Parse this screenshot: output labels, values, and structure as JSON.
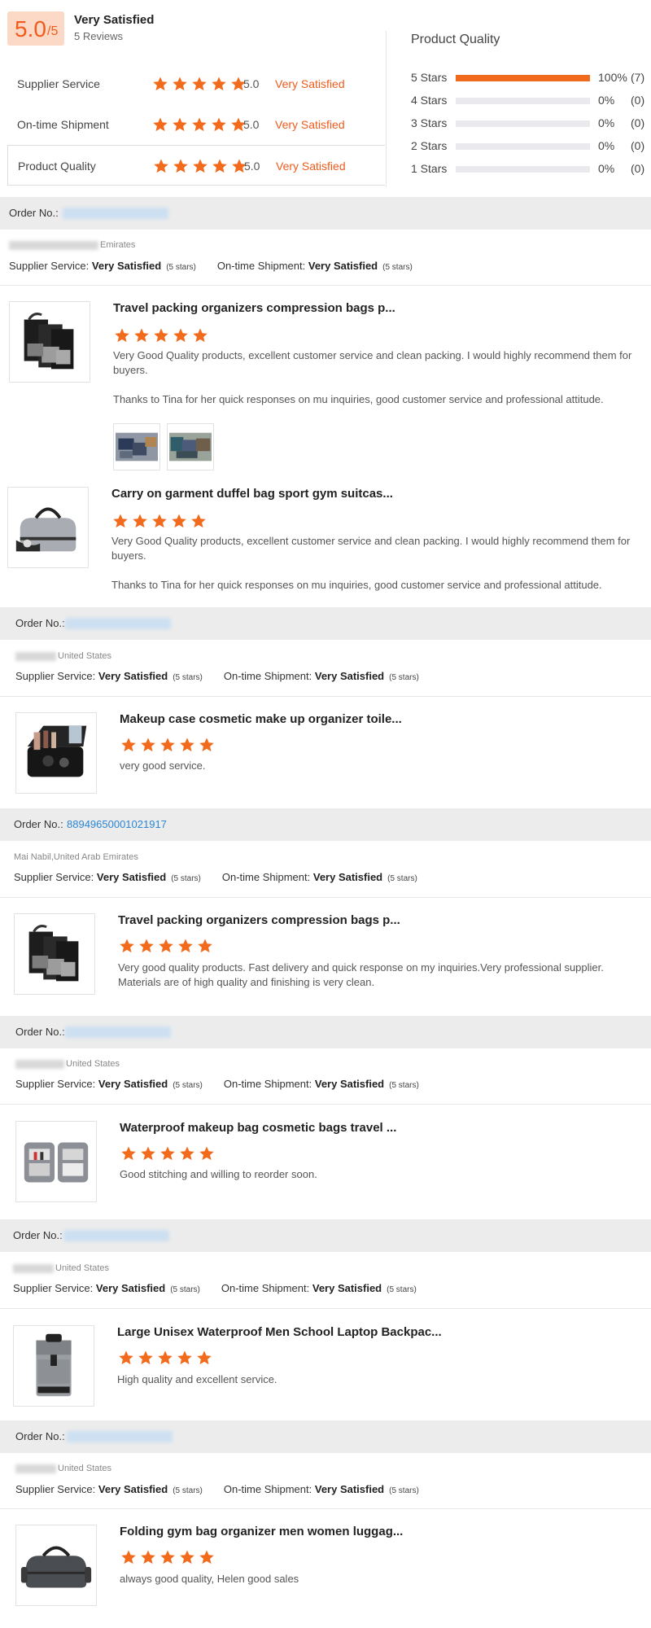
{
  "summary": {
    "score": "5.0",
    "score_suffix": "/5",
    "label": "Very Satisfied",
    "reviews": "5 Reviews",
    "metrics": [
      {
        "name": "Supplier Service",
        "score": "5.0",
        "text": "Very Satisfied",
        "stars": 5
      },
      {
        "name": "On-time Shipment",
        "score": "5.0",
        "text": "Very Satisfied",
        "stars": 5
      },
      {
        "name": "Product Quality",
        "score": "5.0",
        "text": "Very Satisfied",
        "stars": 5
      }
    ]
  },
  "quality": {
    "title": "Product Quality",
    "rows": [
      {
        "label": "5 Stars",
        "pct": "100%",
        "count": "(7)",
        "fraction": 1.0
      },
      {
        "label": "4 Stars",
        "pct": "0%",
        "count": "(0)",
        "fraction": 0
      },
      {
        "label": "3 Stars",
        "pct": "0%",
        "count": "(0)",
        "fraction": 0
      },
      {
        "label": "2 Stars",
        "pct": "0%",
        "count": "(0)",
        "fraction": 0
      },
      {
        "label": "1 Stars",
        "pct": "0%",
        "count": "(0)",
        "fraction": 0
      }
    ]
  },
  "labels": {
    "order_no": "Order No.:",
    "supplier_service": "Supplier Service:",
    "ontime_shipment": "On-time Shipment:",
    "very_satisfied": "Very Satisfied",
    "five_stars": "(5 stars)"
  },
  "reviews": [
    {
      "order_number": "",
      "buyer": "Emirates",
      "products": [
        {
          "title": "Travel packing organizers compression bags p...",
          "stars": 5,
          "text": "Very Good Quality products, excellent customer service and clean packing. I would highly recommend them for buyers.",
          "text2": "Thanks to Tina for her quick responses on mu inquiries, good customer service and professional attitude.",
          "icon": "packing-cubes-image",
          "photos": [
            "review-photo-1",
            "review-photo-2"
          ]
        },
        {
          "title": "Carry on garment duffel bag sport gym suitcas...",
          "stars": 5,
          "text": "Very Good Quality products, excellent customer service and clean packing. I would highly recommend them for buyers.",
          "text2": "Thanks to Tina for her quick responses on mu inquiries, good customer service and professional attitude.",
          "icon": "duffel-bag-image"
        }
      ]
    },
    {
      "order_number": "",
      "buyer": "United States",
      "products": [
        {
          "title": "Makeup case cosmetic make up organizer toile...",
          "stars": 5,
          "text": "very good service.",
          "icon": "makeup-case-image"
        }
      ]
    },
    {
      "order_number": "88949650001021917",
      "buyer": "Mai Nabil,United Arab Emirates",
      "products": [
        {
          "title": "Travel packing organizers compression bags p...",
          "stars": 5,
          "text": "Very good quality products. Fast delivery and quick response on my inquiries.Very professional supplier. Materials are of high quality and finishing is very clean.",
          "icon": "packing-cubes-image"
        }
      ]
    },
    {
      "order_number": "",
      "buyer": "United States",
      "products": [
        {
          "title": "Waterproof makeup bag cosmetic bags travel ...",
          "stars": 5,
          "text": "Good stitching and willing to reorder soon.",
          "icon": "cosmetic-bag-image"
        }
      ]
    },
    {
      "order_number": "",
      "buyer": "United States",
      "products": [
        {
          "title": "Large Unisex Waterproof Men School Laptop Backpac...",
          "stars": 5,
          "text": "High quality and excellent service.",
          "icon": "backpack-image"
        }
      ]
    },
    {
      "order_number": "",
      "buyer": "United States",
      "products": [
        {
          "title": "Folding gym bag organizer men women luggag...",
          "stars": 5,
          "text": "always good quality, Helen good sales",
          "icon": "gym-bag-image"
        }
      ]
    }
  ],
  "colors": {
    "accent": "#f05b1c",
    "link": "#2a86d6",
    "star": "#f26b1d"
  }
}
